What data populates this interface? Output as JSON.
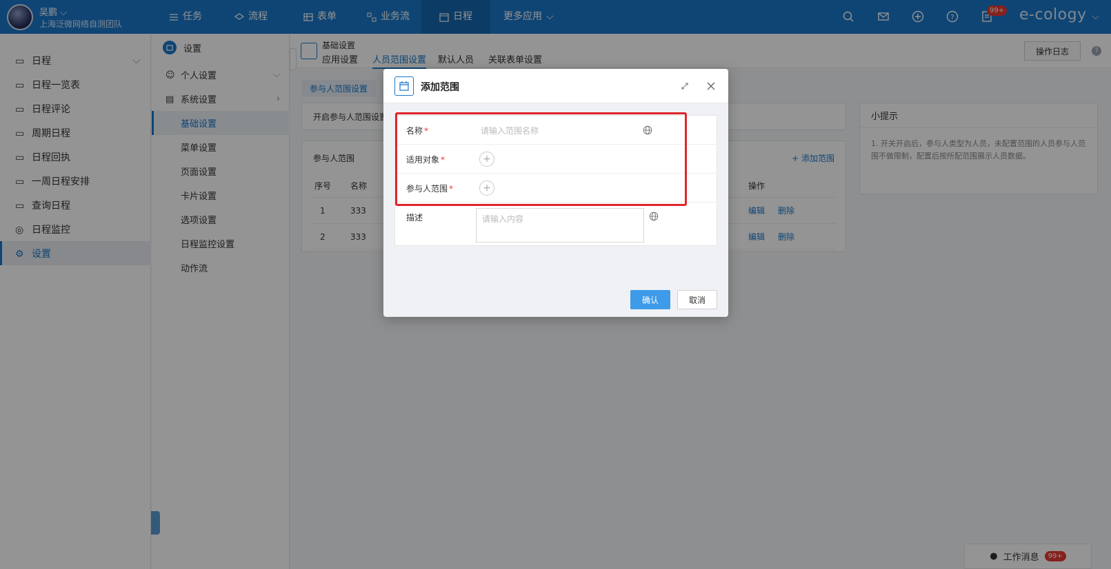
{
  "header": {
    "user_name": "吴鹏",
    "user_team": "上海泛微网络自测团队",
    "nav": [
      {
        "label": "任务",
        "icon": "list-icon"
      },
      {
        "label": "流程",
        "icon": "layers-icon"
      },
      {
        "label": "表单",
        "icon": "table-icon"
      },
      {
        "label": "业务流",
        "icon": "flow-icon"
      },
      {
        "label": "日程",
        "icon": "calendar-icon"
      },
      {
        "label": "更多应用",
        "icon": "chevron-down-icon"
      }
    ],
    "notification_badge": "99+",
    "brand": "e-cology"
  },
  "sidebar": {
    "items": [
      {
        "label": "日程"
      },
      {
        "label": "日程一览表"
      },
      {
        "label": "日程评论"
      },
      {
        "label": "周期日程"
      },
      {
        "label": "日程回执"
      },
      {
        "label": "一周日程安排"
      },
      {
        "label": "查询日程"
      },
      {
        "label": "日程监控"
      },
      {
        "label": "设置"
      }
    ]
  },
  "settings_nav": {
    "title": "设置",
    "items": [
      {
        "label": "个人设置"
      },
      {
        "label": "系统设置"
      },
      {
        "label": "基础设置"
      },
      {
        "label": "菜单设置"
      },
      {
        "label": "页面设置"
      },
      {
        "label": "卡片设置"
      },
      {
        "label": "选项设置"
      },
      {
        "label": "日程监控设置"
      },
      {
        "label": "动作流"
      }
    ]
  },
  "page": {
    "title": "基础设置",
    "tabs": [
      {
        "label": "应用设置"
      },
      {
        "label": "人员范围设置"
      },
      {
        "label": "默认人员"
      },
      {
        "label": "关联表单设置"
      }
    ],
    "log_button": "操作日志",
    "help": "?",
    "sub_tab": "参与人范围设置",
    "switch_label": "开启参与人范围设置",
    "range_title": "参与人范围",
    "add_range": "+ 添加范围",
    "columns": {
      "index": "序号",
      "name": "名称",
      "action": "操作"
    },
    "rows": [
      {
        "index": "1",
        "name": "333",
        "edit": "编辑",
        "delete": "删除"
      },
      {
        "index": "2",
        "name": "333",
        "edit": "编辑",
        "delete": "删除"
      }
    ],
    "tip_title": "小提示",
    "tip_text": "1. 开关开启后，参与人类型为人员，未配置范围的人员参与人范围不做限制，配置后按所配范围展示人员数据。"
  },
  "modal": {
    "title": "添加范围",
    "fields": {
      "name_label": "名称",
      "name_placeholder": "请输入范围名称",
      "target_label": "适用对象",
      "participants_label": "参与人范围",
      "desc_label": "描述",
      "desc_placeholder": "请输入内容",
      "required_mark": "*"
    },
    "confirm": "确认",
    "cancel": "取消"
  },
  "message_bar": {
    "label": "工作消息",
    "badge": "99+"
  },
  "colors": {
    "primary": "#1a77c9",
    "highlight": "#e0242a",
    "badge": "#e53935"
  }
}
